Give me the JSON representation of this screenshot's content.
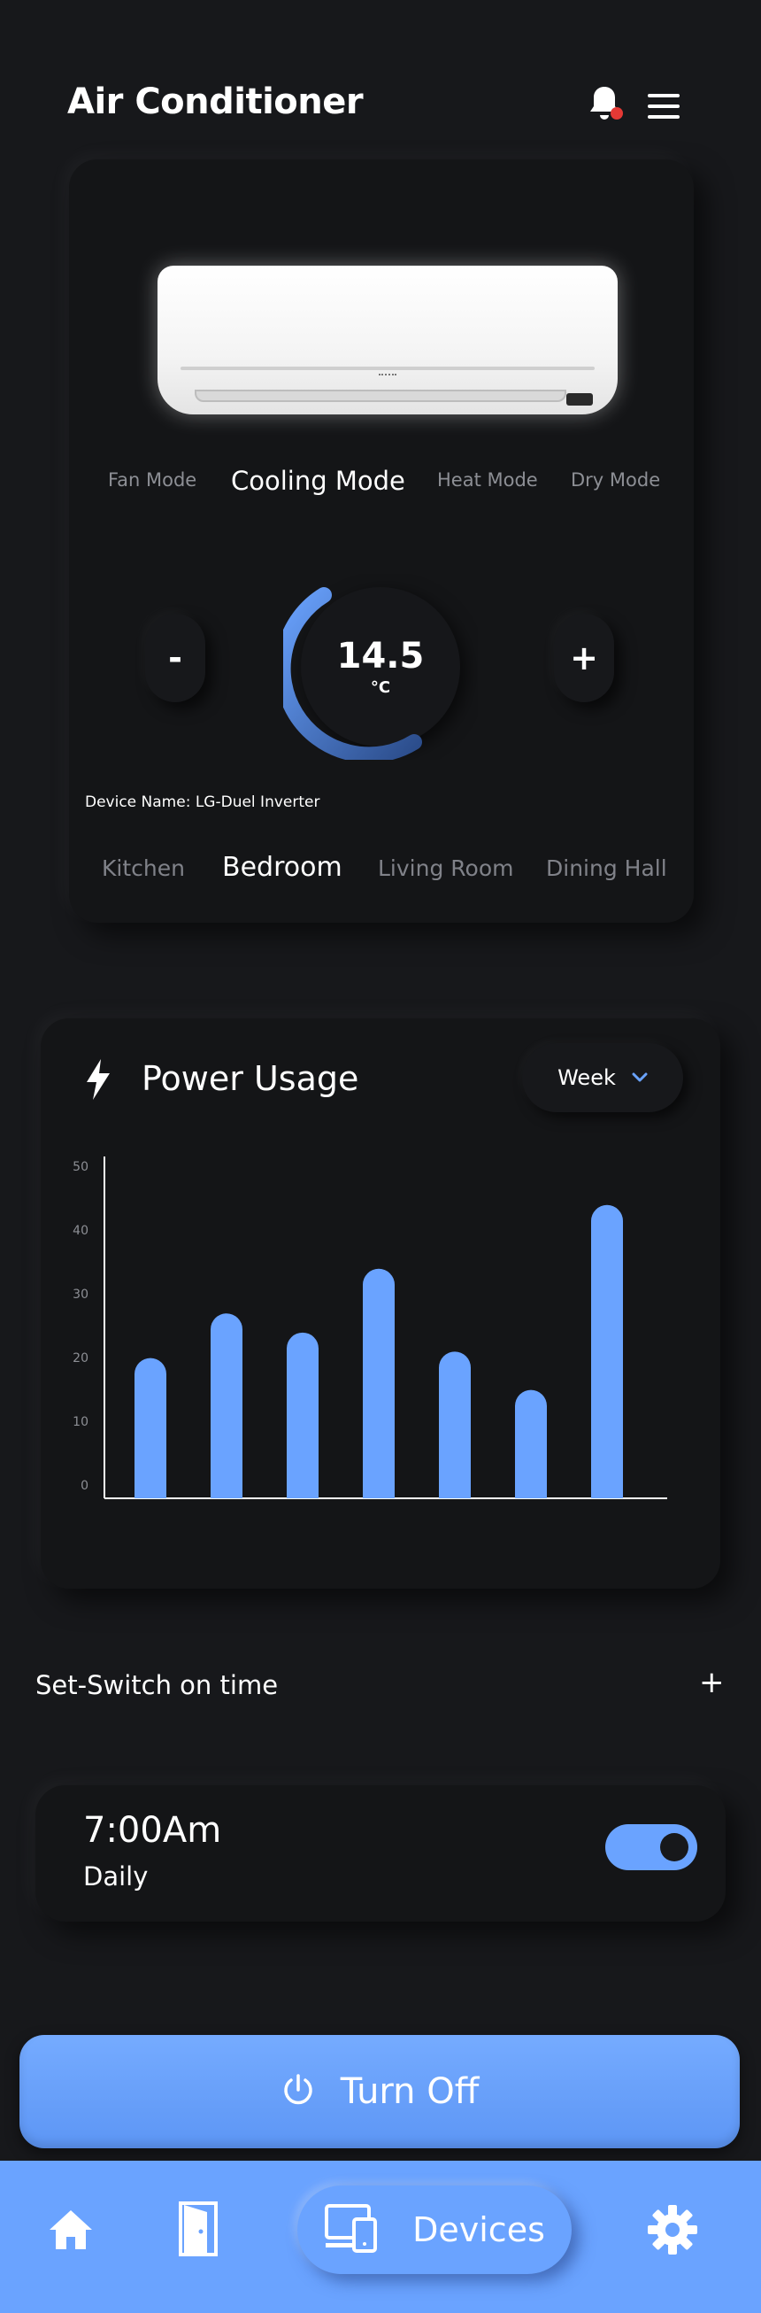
{
  "header": {
    "title": "Air Conditioner",
    "notification_dot_color": "#e53935"
  },
  "modes": [
    {
      "label": "Fan Mode",
      "active": false
    },
    {
      "label": "Cooling Mode",
      "active": true
    },
    {
      "label": "Heat Mode",
      "active": false
    },
    {
      "label": "Dry Mode",
      "active": false
    }
  ],
  "thermostat": {
    "minus_label": "-",
    "plus_label": "+",
    "temperature": "14.5",
    "unit": "°C"
  },
  "device": {
    "name_label": "Device Name: LG-Duel Inverter"
  },
  "rooms": [
    {
      "label": "Kitchen",
      "active": false
    },
    {
      "label": "Bedroom",
      "active": true
    },
    {
      "label": "Living Room",
      "active": false
    },
    {
      "label": "Dining Hall",
      "active": false
    }
  ],
  "power_usage": {
    "title": "Power Usage",
    "period_label": "Week"
  },
  "chart_data": {
    "type": "bar",
    "title": "",
    "xlabel": "",
    "ylabel": "",
    "ylim": [
      0,
      50
    ],
    "yticks": [
      "0",
      "10",
      "20",
      "30",
      "40",
      "50"
    ],
    "categories": [
      "",
      "",
      "",
      "",
      "",
      "",
      ""
    ],
    "values": [
      22,
      29,
      26,
      36,
      23,
      17,
      46
    ],
    "color": "#6aa3ff",
    "grid": false
  },
  "schedule": {
    "title": "Set-Switch on time",
    "add_label": "+",
    "time": "7:00Am",
    "frequency": "Daily",
    "enabled": true
  },
  "actions": {
    "turn_off_label": "Turn Off"
  },
  "nav": {
    "devices_label": "Devices"
  },
  "colors": {
    "accent": "#6aa3ff",
    "background": "#17181b"
  }
}
